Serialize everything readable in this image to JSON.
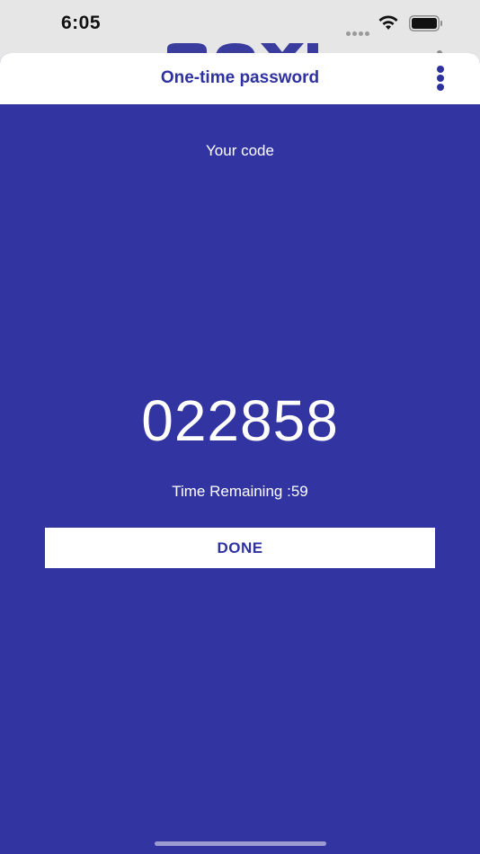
{
  "status_bar": {
    "time": "6:05",
    "icons": [
      "signal-dots-icon",
      "wifi-icon",
      "battery-icon"
    ]
  },
  "sheet": {
    "title": "One-time password",
    "menu_icon": "vertical-ellipsis-icon"
  },
  "otp": {
    "caption": "Your code",
    "code": "022858",
    "timer_label": "Time Remaining :",
    "timer_value": "59"
  },
  "actions": {
    "done_label": "DONE"
  },
  "colors": {
    "accent": "#2e31a0",
    "sheet_background": "#3134a1",
    "header_background": "#ffffff",
    "text_on_accent": "#ffffff"
  }
}
